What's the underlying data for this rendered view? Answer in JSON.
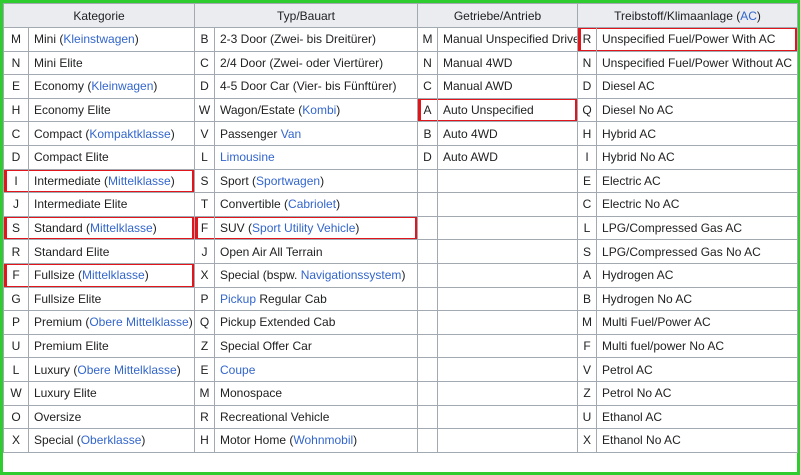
{
  "headers": {
    "kategorie": "Kategorie",
    "typ": "Typ/Bauart",
    "getriebe": "Getriebe/Antrieb",
    "treibstoff_pre": "Treibstoff/Klimaanlage (",
    "treibstoff_link": "AC",
    "treibstoff_post": ")"
  },
  "colors": {
    "link": "#3366cc",
    "highlight": "#e0161c",
    "frame": "#2ecc2e"
  },
  "rows": [
    {
      "k": {
        "code": "M",
        "pre": "Mini (",
        "link": "Kleinstwagen",
        "post": ")"
      },
      "t": {
        "code": "B",
        "pre": "2-3 Door (Zwei- bis Dreitürer)",
        "link": "",
        "post": ""
      },
      "g": {
        "code": "M",
        "text": "Manual Unspecified Drive"
      },
      "f": {
        "code": "R",
        "text": "Unspecified Fuel/Power With AC"
      }
    },
    {
      "k": {
        "code": "N",
        "pre": "Mini Elite",
        "link": "",
        "post": ""
      },
      "t": {
        "code": "C",
        "pre": "2/4 Door (Zwei- oder Viertürer)",
        "link": "",
        "post": ""
      },
      "g": {
        "code": "N",
        "text": "Manual 4WD"
      },
      "f": {
        "code": "N",
        "text": "Unspecified Fuel/Power Without AC"
      }
    },
    {
      "k": {
        "code": "E",
        "pre": "Economy (",
        "link": "Kleinwagen",
        "post": ")"
      },
      "t": {
        "code": "D",
        "pre": "4-5 Door Car (Vier- bis Fünftürer)",
        "link": "",
        "post": ""
      },
      "g": {
        "code": "C",
        "text": "Manual AWD"
      },
      "f": {
        "code": "D",
        "text": "Diesel AC"
      }
    },
    {
      "k": {
        "code": "H",
        "pre": "Economy Elite",
        "link": "",
        "post": ""
      },
      "t": {
        "code": "W",
        "pre": "Wagon/Estate (",
        "link": "Kombi",
        "post": ")"
      },
      "g": {
        "code": "A",
        "text": "Auto Unspecified"
      },
      "f": {
        "code": "Q",
        "text": "Diesel No AC"
      }
    },
    {
      "k": {
        "code": "C",
        "pre": "Compact (",
        "link": "Kompaktklasse",
        "post": ")"
      },
      "t": {
        "code": "V",
        "pre": "Passenger ",
        "link": "Van",
        "post": ""
      },
      "g": {
        "code": "B",
        "text": "Auto 4WD"
      },
      "f": {
        "code": "H",
        "text": "Hybrid AC"
      }
    },
    {
      "k": {
        "code": "D",
        "pre": "Compact Elite",
        "link": "",
        "post": ""
      },
      "t": {
        "code": "L",
        "pre": "",
        "link": "Limousine",
        "post": ""
      },
      "g": {
        "code": "D",
        "text": "Auto AWD"
      },
      "f": {
        "code": "I",
        "text": "Hybrid No AC"
      }
    },
    {
      "k": {
        "code": "I",
        "pre": "Intermediate (",
        "link": "Mittelklasse",
        "post": ")"
      },
      "t": {
        "code": "S",
        "pre": "Sport (",
        "link": "Sportwagen",
        "post": ")"
      },
      "g": {
        "code": "",
        "text": ""
      },
      "f": {
        "code": "E",
        "text": "Electric AC"
      }
    },
    {
      "k": {
        "code": "J",
        "pre": "Intermediate Elite",
        "link": "",
        "post": ""
      },
      "t": {
        "code": "T",
        "pre": "Convertible (",
        "link": "Cabriolet",
        "post": ")"
      },
      "g": {
        "code": "",
        "text": ""
      },
      "f": {
        "code": "C",
        "text": "Electric No AC"
      }
    },
    {
      "k": {
        "code": "S",
        "pre": "Standard (",
        "link": "Mittelklasse",
        "post": ")"
      },
      "t": {
        "code": "F",
        "pre": "SUV (",
        "link": "Sport Utility Vehicle",
        "post": ")"
      },
      "g": {
        "code": "",
        "text": ""
      },
      "f": {
        "code": "L",
        "text": "LPG/Compressed Gas AC"
      }
    },
    {
      "k": {
        "code": "R",
        "pre": "Standard Elite",
        "link": "",
        "post": ""
      },
      "t": {
        "code": "J",
        "pre": "Open Air All Terrain",
        "link": "",
        "post": ""
      },
      "g": {
        "code": "",
        "text": ""
      },
      "f": {
        "code": "S",
        "text": "LPG/Compressed Gas No AC"
      }
    },
    {
      "k": {
        "code": "F",
        "pre": "Fullsize (",
        "link": "Mittelklasse",
        "post": ")"
      },
      "t": {
        "code": "X",
        "pre": "Special (bspw. ",
        "link": "Navigationssystem",
        "post": ")"
      },
      "g": {
        "code": "",
        "text": ""
      },
      "f": {
        "code": "A",
        "text": "Hydrogen AC"
      }
    },
    {
      "k": {
        "code": "G",
        "pre": "Fullsize Elite",
        "link": "",
        "post": ""
      },
      "t": {
        "code": "P",
        "pre": "",
        "link": "Pickup",
        "post": " Regular Cab"
      },
      "g": {
        "code": "",
        "text": ""
      },
      "f": {
        "code": "B",
        "text": "Hydrogen No AC"
      }
    },
    {
      "k": {
        "code": "P",
        "pre": "Premium (",
        "link": "Obere Mittelklasse",
        "post": ")"
      },
      "t": {
        "code": "Q",
        "pre": "Pickup Extended Cab",
        "link": "",
        "post": ""
      },
      "g": {
        "code": "",
        "text": ""
      },
      "f": {
        "code": "M",
        "text": "Multi Fuel/Power AC"
      }
    },
    {
      "k": {
        "code": "U",
        "pre": "Premium Elite",
        "link": "",
        "post": ""
      },
      "t": {
        "code": "Z",
        "pre": "Special Offer Car",
        "link": "",
        "post": ""
      },
      "g": {
        "code": "",
        "text": ""
      },
      "f": {
        "code": "F",
        "text": "Multi fuel/power No AC"
      }
    },
    {
      "k": {
        "code": "L",
        "pre": "Luxury (",
        "link": "Obere Mittelklasse",
        "post": ")"
      },
      "t": {
        "code": "E",
        "pre": "",
        "link": "Coupe",
        "post": ""
      },
      "g": {
        "code": "",
        "text": ""
      },
      "f": {
        "code": "V",
        "text": "Petrol AC"
      }
    },
    {
      "k": {
        "code": "W",
        "pre": "Luxury Elite",
        "link": "",
        "post": ""
      },
      "t": {
        "code": "M",
        "pre": "Monospace",
        "link": "",
        "post": ""
      },
      "g": {
        "code": "",
        "text": ""
      },
      "f": {
        "code": "Z",
        "text": "Petrol No AC"
      }
    },
    {
      "k": {
        "code": "O",
        "pre": "Oversize",
        "link": "",
        "post": ""
      },
      "t": {
        "code": "R",
        "pre": "Recreational Vehicle",
        "link": "",
        "post": ""
      },
      "g": {
        "code": "",
        "text": ""
      },
      "f": {
        "code": "U",
        "text": "Ethanol AC"
      }
    },
    {
      "k": {
        "code": "X",
        "pre": "Special (",
        "link": "Oberklasse",
        "post": ")"
      },
      "t": {
        "code": "H",
        "pre": "Motor Home (",
        "link": "Wohnmobil",
        "post": ")"
      },
      "g": {
        "code": "",
        "text": ""
      },
      "f": {
        "code": "X",
        "text": "Ethanol No AC"
      }
    }
  ]
}
